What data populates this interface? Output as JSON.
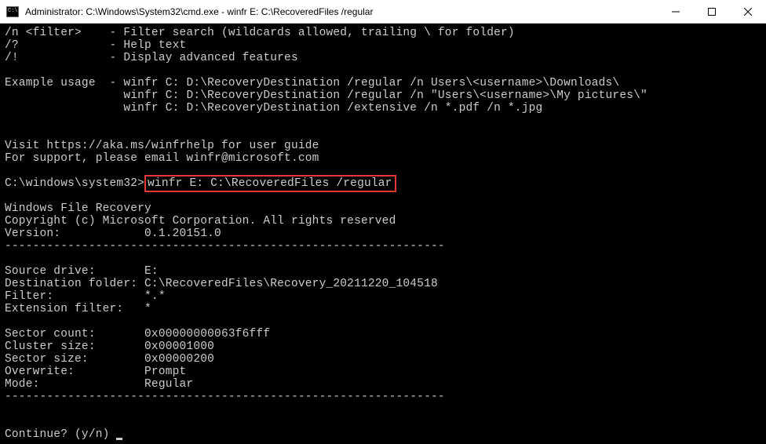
{
  "titlebar": {
    "title": "Administrator: C:\\Windows\\System32\\cmd.exe - winfr  E: C:\\RecoveredFiles /regular"
  },
  "terminal": {
    "line_filter": "/n <filter>    - Filter search (wildcards allowed, trailing \\ for folder)",
    "line_help": "/?             - Help text",
    "line_advanced": "/!             - Display advanced features",
    "blank": "",
    "example_label": "Example usage  - ",
    "example1": "winfr C: D:\\RecoveryDestination /regular /n Users\\<username>\\Downloads\\",
    "example2_pad": "                 ",
    "example2": "winfr C: D:\\RecoveryDestination /regular /n \"Users\\<username>\\My pictures\\\"",
    "example3_pad": "                 ",
    "example3": "winfr C: D:\\RecoveryDestination /extensive /n *.pdf /n *.jpg",
    "visit": "Visit https://aka.ms/winfrhelp for user guide",
    "support": "For support, please email winfr@microsoft.com",
    "prompt_path": "C:\\windows\\system32>",
    "command": "winfr E: C:\\RecoveredFiles /regular",
    "app_name": "Windows File Recovery",
    "copyright": "Copyright (c) Microsoft Corporation. All rights reserved",
    "version_line": "Version:            0.1.20151.0",
    "divider": "---------------------------------------------------------------",
    "source_drive": "Source drive:       E:",
    "dest_folder": "Destination folder: C:\\RecoveredFiles\\Recovery_20211220_104518",
    "filter_line": "Filter:             *.*",
    "ext_filter": "Extension filter:   *",
    "sector_count": "Sector count:       0x00000000063f6fff",
    "cluster_size": "Cluster size:       0x00001000",
    "sector_size": "Sector size:        0x00000200",
    "overwrite": "Overwrite:          Prompt",
    "mode": "Mode:               Regular",
    "continue_prompt": "Continue? (y/n) "
  }
}
